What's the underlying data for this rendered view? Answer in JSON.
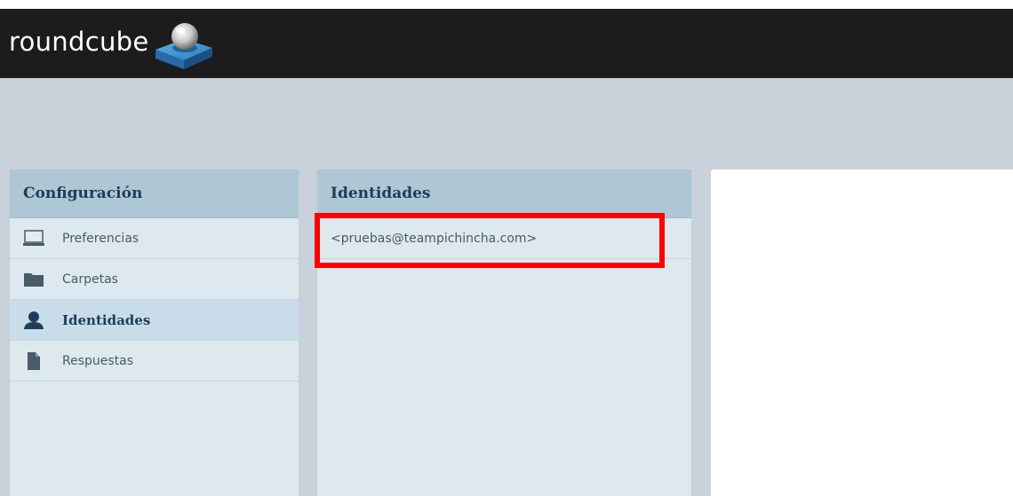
{
  "header": {
    "logo_text": "roundcube",
    "logo_icon": "roundcube-cube-logo"
  },
  "settings": {
    "title": "Configuración",
    "items": [
      {
        "label": "Preferencias",
        "icon": "monitor-icon",
        "selected": false
      },
      {
        "label": "Carpetas",
        "icon": "folder-icon",
        "selected": false
      },
      {
        "label": "Identidades",
        "icon": "user-icon",
        "selected": true
      },
      {
        "label": "Respuestas",
        "icon": "document-icon",
        "selected": false
      }
    ]
  },
  "identities": {
    "title": "Identidades",
    "items": [
      {
        "label": "<pruebas@teampichincha.com>"
      }
    ]
  },
  "colors": {
    "topbar": "#1c1c1c",
    "background": "#c9d2da",
    "panel": "#dde8ef",
    "panel_header": "#adc8d4",
    "selected": "#c8dde9",
    "highlight": "#ff0000",
    "title_text": "#1e3d56"
  }
}
